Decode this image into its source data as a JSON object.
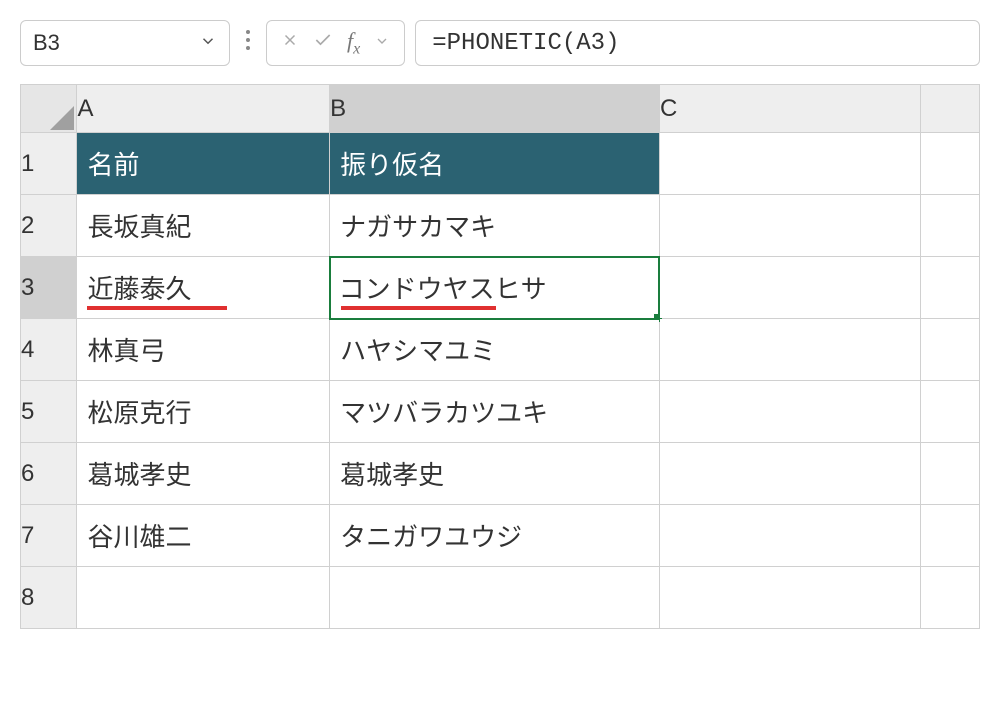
{
  "formula_bar": {
    "name_box": "B3",
    "formula": "=PHONETIC(A3)"
  },
  "columns": {
    "a": "A",
    "b": "B",
    "c": "C"
  },
  "rows": [
    "1",
    "2",
    "3",
    "4",
    "5",
    "6",
    "7",
    "8"
  ],
  "headers": {
    "name": "名前",
    "furigana": "振り仮名"
  },
  "data": [
    {
      "name": "長坂真紀",
      "furigana": "ナガサカマキ"
    },
    {
      "name": "近藤泰久",
      "furigana": "コンドウヤスヒサ"
    },
    {
      "name": "林真弓",
      "furigana": "ハヤシマユミ"
    },
    {
      "name": "松原克行",
      "furigana": "マツバラカツユキ"
    },
    {
      "name": "葛城孝史",
      "furigana": "葛城孝史"
    },
    {
      "name": "谷川雄二",
      "furigana": "タニガワユウジ"
    }
  ],
  "icons": {
    "chevron_down": "⌄",
    "vdots": "⋮",
    "cancel": "✕",
    "enter": "✓",
    "fx": "fx"
  }
}
